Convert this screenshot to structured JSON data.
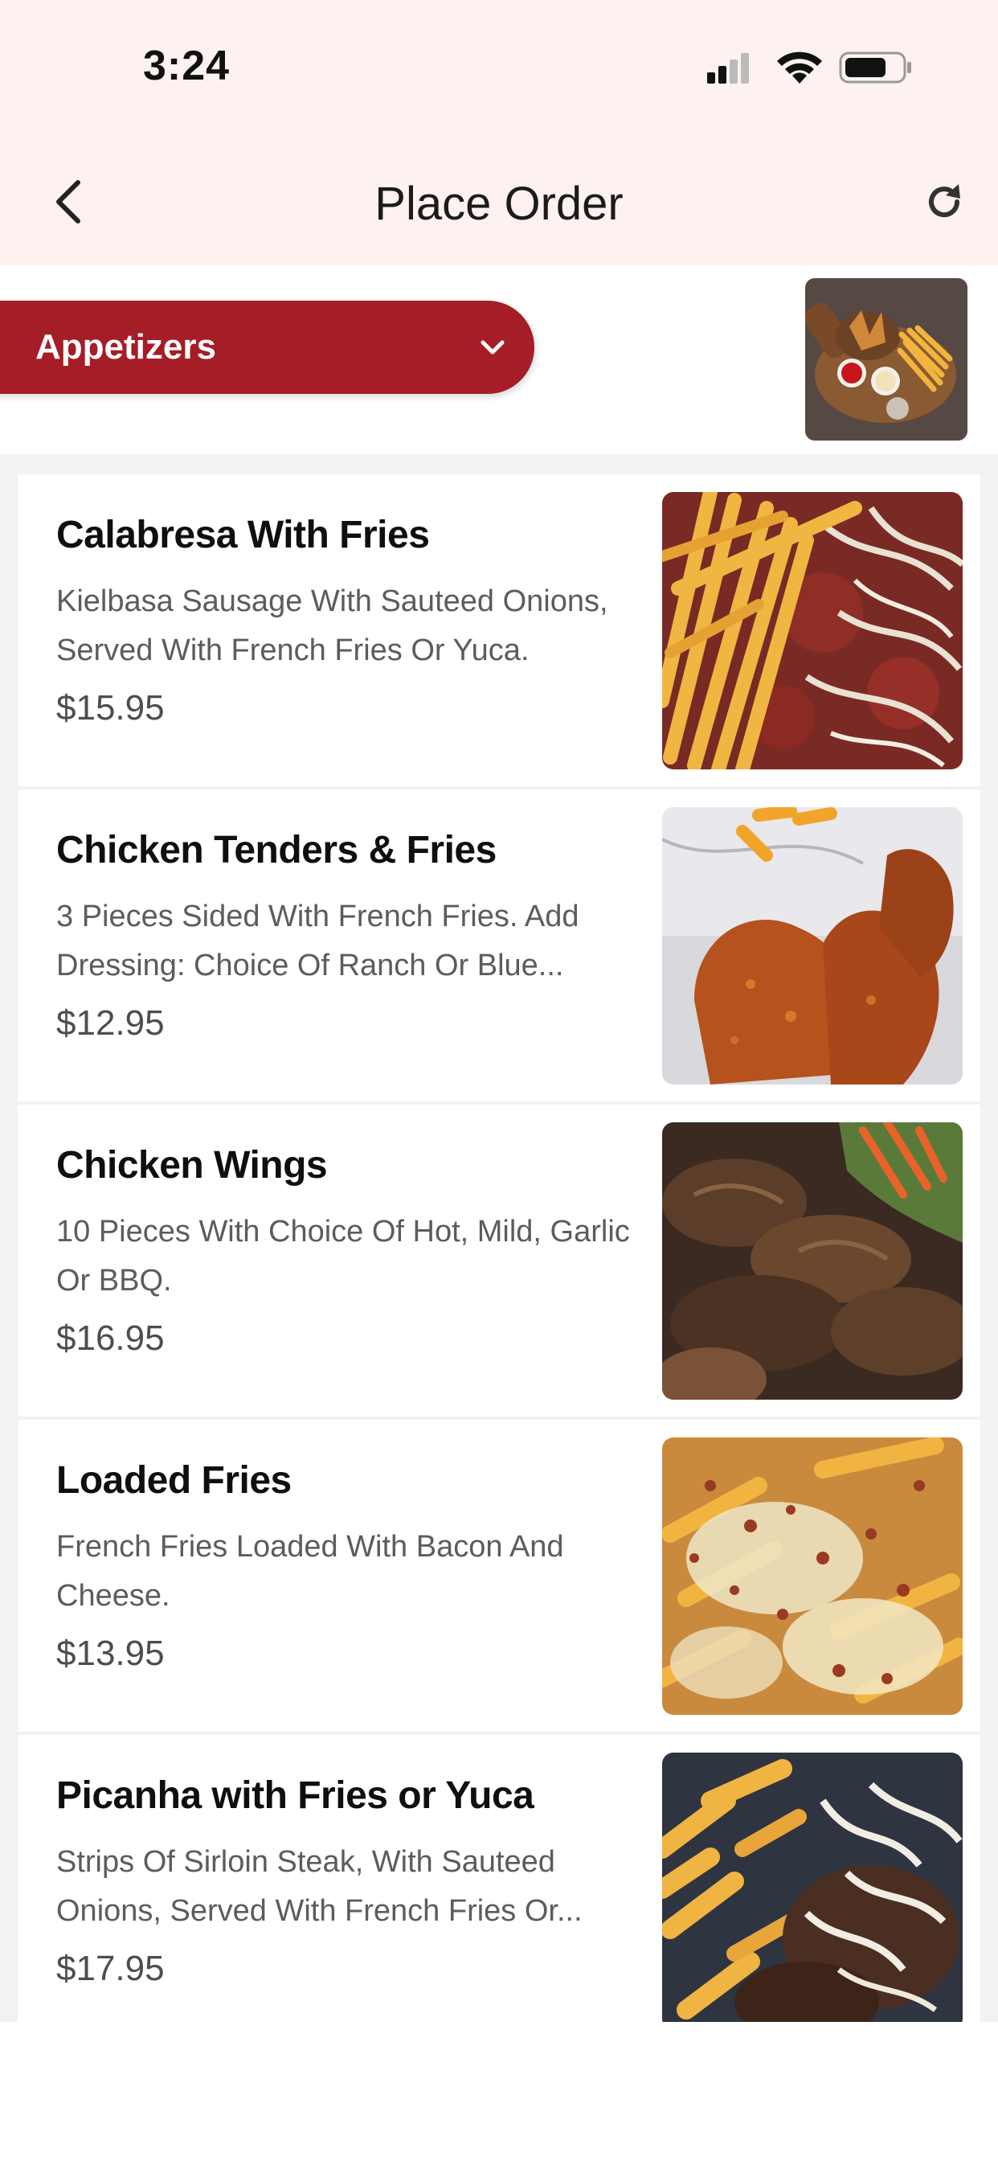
{
  "status_bar": {
    "time": "3:24"
  },
  "nav": {
    "title": "Place Order"
  },
  "category": {
    "selected": "Appetizers"
  },
  "menu_items": [
    {
      "name": "Calabresa With Fries",
      "description": "Kielbasa Sausage With Sauteed Onions, Served With French Fries Or Yuca.",
      "price": "$15.95"
    },
    {
      "name": "Chicken Tenders & Fries",
      "description": "3 Pieces Sided With French Fries. Add Dressing: Choice Of Ranch Or Blue...",
      "price": "$12.95"
    },
    {
      "name": "Chicken Wings",
      "description": "10 Pieces With Choice Of Hot, Mild, Garlic Or BBQ.",
      "price": "$16.95"
    },
    {
      "name": "Loaded Fries",
      "description": "French Fries Loaded With Bacon And Cheese.",
      "price": "$13.95"
    },
    {
      "name": "Picanha with Fries or Yuca",
      "description": "Strips Of Sirloin Steak, With Sauteed Onions, Served With French Fries Or...",
      "price": "$17.95"
    }
  ],
  "colors": {
    "accent": "#a51d27",
    "header_bg": "#fdf2f0",
    "list_bg": "#f3f1f1"
  },
  "icons": [
    "signal-icon",
    "wifi-icon",
    "battery-icon",
    "back-arrow-icon",
    "refresh-icon",
    "chevron-down-icon"
  ]
}
